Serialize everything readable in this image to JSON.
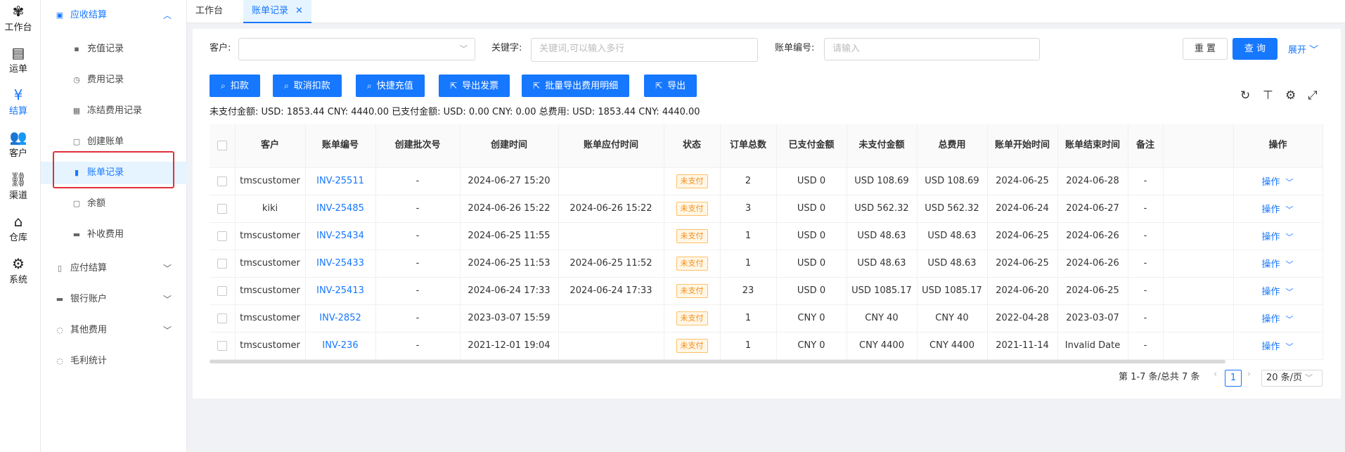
{
  "rail": [
    {
      "label": "工作台",
      "icon": "grid-icon"
    },
    {
      "label": "运单",
      "icon": "list-icon"
    },
    {
      "label": "结算",
      "icon": "money-icon"
    },
    {
      "label": "客户",
      "icon": "people-icon"
    },
    {
      "label": "渠道",
      "icon": "channel-icon"
    },
    {
      "label": "仓库",
      "icon": "warehouse-icon"
    },
    {
      "label": "系统",
      "icon": "gear-icon"
    }
  ],
  "sidebar": {
    "group_open": "应收结算",
    "items": [
      "充值记录",
      "费用记录",
      "冻结费用记录",
      "创建账单",
      "账单记录",
      "余额",
      "补收费用"
    ],
    "groups": [
      "应付结算",
      "银行账户",
      "其他费用",
      "毛利统计"
    ]
  },
  "tabs": [
    "工作台",
    "账单记录"
  ],
  "filters": {
    "customer_label": "客户:",
    "keyword_label": "关键字:",
    "keyword_placeholder": "关键词,可以输入多行",
    "billno_label": "账单编号:",
    "billno_placeholder": "请输入",
    "reset": "重 置",
    "query": "查 询",
    "expand": "展开"
  },
  "actions": [
    "扣款",
    "取消扣款",
    "快捷充值",
    "导出发票",
    "批量导出费用明细",
    "导出"
  ],
  "summary": "未支付金额: USD: 1853.44 CNY: 4440.00  已支付金额: USD: 0.00 CNY: 0.00  总费用: USD: 1853.44 CNY: 4440.00",
  "table": {
    "headers": [
      "客户",
      "账单编号",
      "创建批次号",
      "创建时间",
      "账单应付时间",
      "状态",
      "订单总数",
      "已支付金额",
      "未支付金额",
      "总费用",
      "账单开始时间",
      "账单结束时间",
      "备注",
      "",
      "操作"
    ],
    "rows": [
      [
        "tmscustomer",
        "INV-25511",
        "-",
        "2024-06-27 15:20",
        "",
        "未支付",
        "2",
        "USD 0",
        "USD 108.69",
        "USD 108.69",
        "2024-06-25",
        "2024-06-28",
        "-",
        "",
        "操作"
      ],
      [
        "kiki",
        "INV-25485",
        "-",
        "2024-06-26 15:22",
        "2024-06-26 15:22",
        "未支付",
        "3",
        "USD 0",
        "USD 562.32",
        "USD 562.32",
        "2024-06-24",
        "2024-06-27",
        "-",
        "",
        "操作"
      ],
      [
        "tmscustomer",
        "INV-25434",
        "-",
        "2024-06-25 11:55",
        "",
        "未支付",
        "1",
        "USD 0",
        "USD 48.63",
        "USD 48.63",
        "2024-06-25",
        "2024-06-26",
        "-",
        "",
        "操作"
      ],
      [
        "tmscustomer",
        "INV-25433",
        "-",
        "2024-06-25 11:53",
        "2024-06-25 11:52",
        "未支付",
        "1",
        "USD 0",
        "USD 48.63",
        "USD 48.63",
        "2024-06-25",
        "2024-06-26",
        "-",
        "",
        "操作"
      ],
      [
        "tmscustomer",
        "INV-25413",
        "-",
        "2024-06-24 17:33",
        "2024-06-24 17:33",
        "未支付",
        "23",
        "USD 0",
        "USD 1085.17",
        "USD 1085.17",
        "2024-06-20",
        "2024-06-25",
        "-",
        "",
        "操作"
      ],
      [
        "tmscustomer",
        "INV-2852",
        "-",
        "2023-03-07 15:59",
        "",
        "未支付",
        "1",
        "CNY 0",
        "CNY 40",
        "CNY 40",
        "2022-04-28",
        "2023-03-07",
        "-",
        "",
        "操作"
      ],
      [
        "tmscustomer",
        "INV-236",
        "-",
        "2021-12-01 19:04",
        "",
        "未支付",
        "1",
        "CNY 0",
        "CNY 4400",
        "CNY 4400",
        "2021-11-14",
        "Invalid Date",
        "-",
        "",
        "操作"
      ]
    ]
  },
  "pagination": {
    "range": "第 1-7 条/总共 7 条",
    "page": "1",
    "page_size": "20 条/页"
  }
}
